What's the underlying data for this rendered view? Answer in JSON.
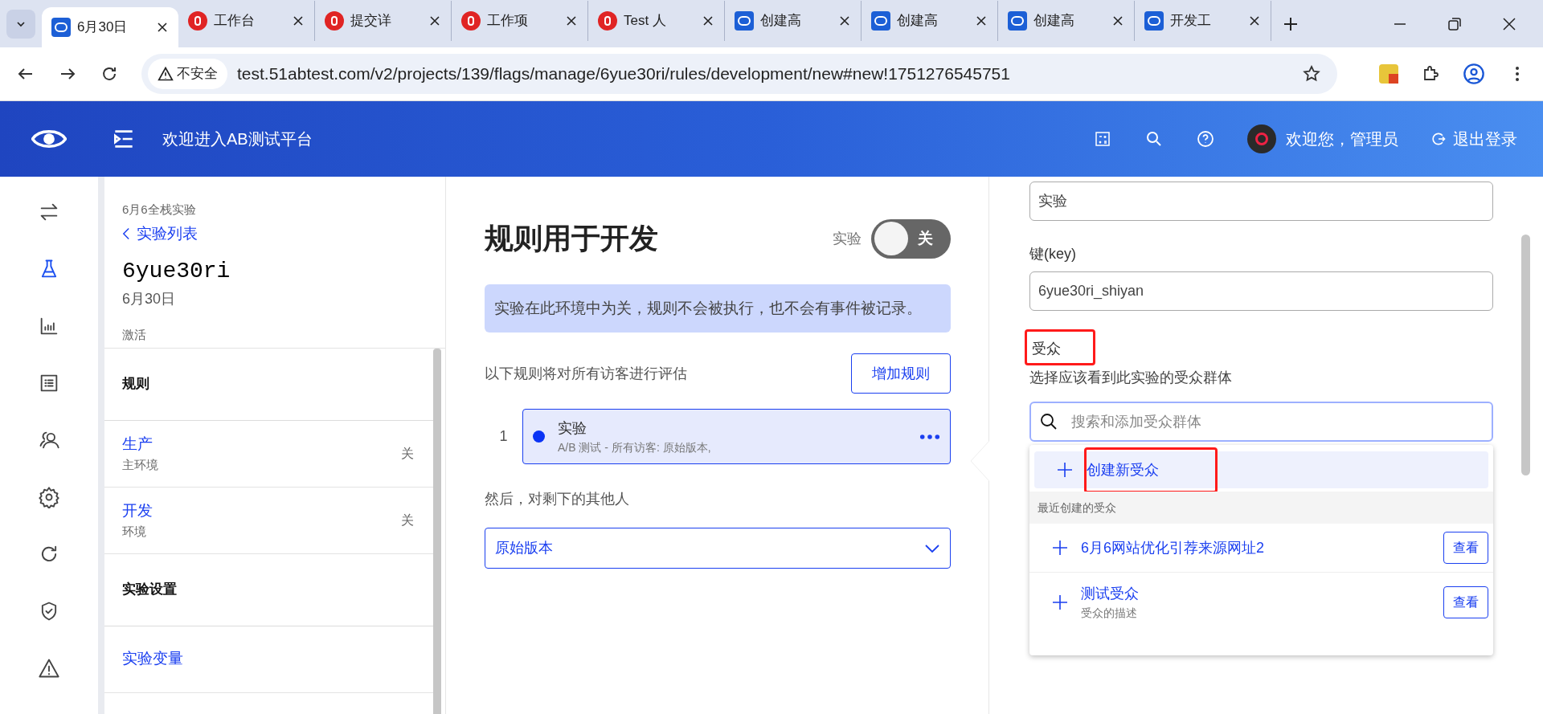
{
  "browser": {
    "tabs": [
      {
        "title": "6月30日",
        "kind": "eye",
        "selected": true
      },
      {
        "title": "工作台",
        "kind": "red",
        "selected": false
      },
      {
        "title": "提交详",
        "kind": "red",
        "selected": false
      },
      {
        "title": "工作项",
        "kind": "red",
        "selected": false
      },
      {
        "title": "Test 人",
        "kind": "red",
        "selected": false
      },
      {
        "title": "创建高",
        "kind": "eye",
        "selected": false
      },
      {
        "title": "创建高",
        "kind": "eye",
        "selected": false
      },
      {
        "title": "创建高",
        "kind": "eye",
        "selected": false
      },
      {
        "title": "开发工",
        "kind": "eye",
        "selected": false
      }
    ],
    "security": "不安全",
    "url": "test.51abtest.com/v2/projects/139/flags/manage/6yue30ri/rules/development/new#new!1751276545751"
  },
  "header": {
    "title": "欢迎进入AB测试平台",
    "user": "欢迎您，管理员",
    "logout": "退出登录"
  },
  "rail": [
    {
      "kind": "swap",
      "selected": false
    },
    {
      "kind": "flask",
      "selected": true
    },
    {
      "kind": "chart",
      "selected": false
    },
    {
      "kind": "list",
      "selected": false
    },
    {
      "kind": "users",
      "selected": false
    },
    {
      "kind": "gear",
      "selected": false
    },
    {
      "kind": "refresh",
      "selected": false
    },
    {
      "kind": "shield",
      "selected": false
    },
    {
      "kind": "warning",
      "selected": false
    }
  ],
  "flag": {
    "project": "6月6全栈实验",
    "back": "实验列表",
    "key": "6yue30ri",
    "date": "6月30日",
    "status": "激活"
  },
  "nav": [
    {
      "kind": "heading",
      "label": "规则"
    },
    {
      "kind": "env",
      "label": "生产",
      "sub": "主环境",
      "state": "关"
    },
    {
      "kind": "env",
      "label": "开发",
      "sub": "环境",
      "state": "关"
    },
    {
      "kind": "heading",
      "label": "实验设置"
    },
    {
      "kind": "link",
      "label": "实验变量"
    }
  ],
  "rules": {
    "title": "规则用于开发",
    "toggle_label": "实验",
    "toggle": {
      "on": false,
      "text": "关"
    },
    "notice": "实验在此环境中为关，规则不会被执行，也不会有事件被记录。",
    "intro": "以下规则将对所有访客进行评估",
    "add_button": "增加规则",
    "items": [
      {
        "index": "1",
        "name": "实验",
        "summary": "A/B 测试 - 所有访客: 原始版本,",
        "selected": true
      }
    ],
    "fallback_label": "然后，对剩下的其他人",
    "fallback_value": "原始版本"
  },
  "editor": {
    "name_value": "实验",
    "key_label": "键(key)",
    "key_value": "6yue30ri_shiyan",
    "audience_label": "受众",
    "audience_highlighted": true,
    "audience_hint": "选择应该看到此实验的受众群体",
    "search_placeholder": "搜索和添加受众群体",
    "create": {
      "label": "创建新受众",
      "highlighted": true
    },
    "recent_heading": "最近创建的受众",
    "recent": [
      {
        "name": "6月6网站优化引荐来源网址2",
        "view": "查看"
      },
      {
        "name": "测试受众",
        "description": "受众的描述",
        "view": "查看"
      }
    ]
  }
}
